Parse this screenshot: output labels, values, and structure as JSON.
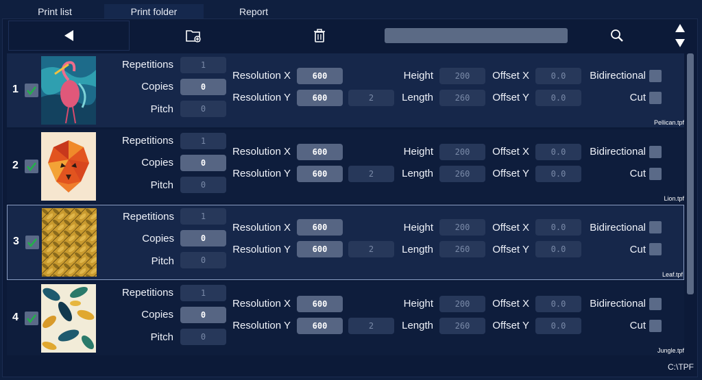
{
  "tabs": [
    "Print list",
    "Print folder",
    "Report"
  ],
  "toolbar": {
    "search_value": ""
  },
  "labels": {
    "repetitions": "Repetitions",
    "copies": "Copies",
    "pitch": "Pitch",
    "resolution_x": "Resolution X",
    "resolution_y": "Resolution Y",
    "height": "Height",
    "length": "Length",
    "offset_x": "Offset X",
    "offset_y": "Offset Y",
    "bidirectional": "Bidirectional",
    "cut": "Cut"
  },
  "items": [
    {
      "num": "1",
      "file": "Pellican.tpf",
      "repetitions": "1",
      "copies": "0",
      "pitch": "0",
      "res_x": "600",
      "res_y": "600",
      "res_y_div": "2",
      "height": "200",
      "length": "260",
      "offset_x": "0.0",
      "offset_y": "0.0"
    },
    {
      "num": "2",
      "file": "Lion.tpf",
      "repetitions": "1",
      "copies": "0",
      "pitch": "0",
      "res_x": "600",
      "res_y": "600",
      "res_y_div": "2",
      "height": "200",
      "length": "260",
      "offset_x": "0.0",
      "offset_y": "0.0"
    },
    {
      "num": "3",
      "file": "Leaf.tpf",
      "repetitions": "1",
      "copies": "0",
      "pitch": "0",
      "res_x": "600",
      "res_y": "600",
      "res_y_div": "2",
      "height": "200",
      "length": "260",
      "offset_x": "0.0",
      "offset_y": "0.0"
    },
    {
      "num": "4",
      "file": "Jungle.tpf",
      "repetitions": "1",
      "copies": "0",
      "pitch": "0",
      "res_x": "600",
      "res_y": "600",
      "res_y_div": "2",
      "height": "200",
      "length": "260",
      "offset_x": "0.0",
      "offset_y": "0.0"
    }
  ],
  "status": {
    "path": "C:\\TPF"
  },
  "colors": {
    "background": "#0f1f3f",
    "row_highlight": "#16274a",
    "check_green": "#22b04a",
    "field_bright": "#566583",
    "field_dim": "#27385a"
  },
  "icons": {
    "back": "back-triangle-icon",
    "new_folder": "folder-plus-icon",
    "delete": "trash-icon",
    "search": "magnifier-icon",
    "move": "up-down-arrows-icon"
  }
}
